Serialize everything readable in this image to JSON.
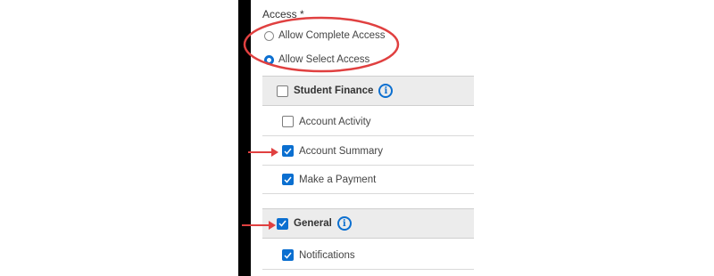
{
  "access": {
    "label": "Access *",
    "options": [
      {
        "label": "Allow Complete Access",
        "selected": false
      },
      {
        "label": "Allow Select Access",
        "selected": true
      }
    ]
  },
  "groups": [
    {
      "title": "Student Finance",
      "checked": false,
      "info_icon": "info-icon",
      "items": [
        {
          "label": "Account Activity",
          "checked": false
        },
        {
          "label": "Account Summary",
          "checked": true
        },
        {
          "label": "Make a Payment",
          "checked": true
        }
      ]
    },
    {
      "title": "General",
      "checked": true,
      "info_icon": "info-icon",
      "items": [
        {
          "label": "Notifications",
          "checked": true
        }
      ]
    }
  ],
  "colors": {
    "accent": "#0b6fd0",
    "annotation": "#e04040",
    "header_bg": "#ececec"
  }
}
